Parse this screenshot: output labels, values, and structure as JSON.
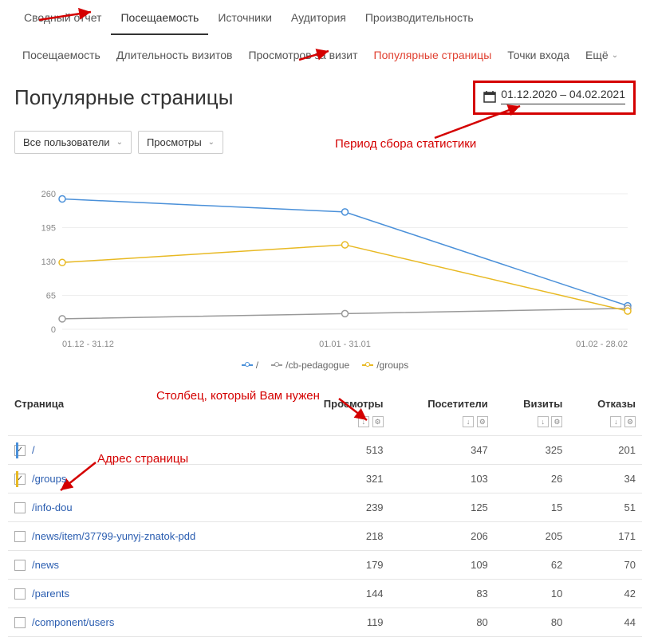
{
  "mainTabs": [
    "Сводный отчет",
    "Посещаемость",
    "Источники",
    "Аудитория",
    "Производительность"
  ],
  "mainTabsActive": 1,
  "subTabs": [
    "Посещаемость",
    "Длительность визитов",
    "Просмотров за визит",
    "Популярные страницы",
    "Точки входа"
  ],
  "subTabsActive": 3,
  "moreLabel": "Ещё",
  "pageTitle": "Популярные страницы",
  "dateRange": "01.12.2020 – 04.02.2021",
  "filters": {
    "users": "Все пользователи",
    "metric": "Просмотры"
  },
  "annotations": {
    "period": "Период сбора статистики",
    "column": "Столбец, который Вам нужен",
    "address": "Адрес страницы"
  },
  "chart_data": {
    "type": "line",
    "x": [
      "01.12 - 31.12",
      "01.01 - 31.01",
      "01.02 - 28.02"
    ],
    "series": [
      {
        "name": "/",
        "color": "#4a90d9",
        "values": [
          250,
          225,
          45
        ]
      },
      {
        "name": "/cb-pedagogue",
        "color": "#999",
        "values": [
          20,
          30,
          40
        ]
      },
      {
        "name": "/groups",
        "color": "#e8b923",
        "values": [
          128,
          162,
          35
        ]
      }
    ],
    "ylim": [
      0,
      260
    ],
    "yticks": [
      0,
      65,
      130,
      195,
      260
    ]
  },
  "table": {
    "headers": [
      "Страница",
      "Просмотры",
      "Посетители",
      "Визиты",
      "Отказы"
    ],
    "rows": [
      {
        "checked": true,
        "marker": "#4a90d9",
        "page": "/",
        "views": 513,
        "visitors": 347,
        "visits": 325,
        "bounces": 201
      },
      {
        "checked": true,
        "marker": "#e8b923",
        "page": "/groups",
        "views": 321,
        "visitors": 103,
        "visits": 26,
        "bounces": 34
      },
      {
        "checked": false,
        "marker": "",
        "page": "/info-dou",
        "views": 239,
        "visitors": 125,
        "visits": 15,
        "bounces": 51
      },
      {
        "checked": false,
        "marker": "",
        "page": "/news/item/37799-yunyj-znatok-pdd",
        "views": 218,
        "visitors": 206,
        "visits": 205,
        "bounces": 171
      },
      {
        "checked": false,
        "marker": "",
        "page": "/news",
        "views": 179,
        "visitors": 109,
        "visits": 62,
        "bounces": 70
      },
      {
        "checked": false,
        "marker": "",
        "page": "/parents",
        "views": 144,
        "visitors": 83,
        "visits": 10,
        "bounces": 42
      },
      {
        "checked": false,
        "marker": "",
        "page": "/component/users",
        "views": 119,
        "visitors": 80,
        "visits": 80,
        "bounces": 44
      }
    ]
  }
}
